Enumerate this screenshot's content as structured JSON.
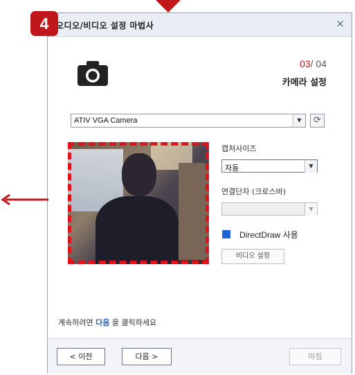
{
  "dialog": {
    "title": "오디오/비디오 설정 마법사",
    "close_glyph": "×"
  },
  "step_badge": "4",
  "step": {
    "current": "03",
    "separator": "/",
    "total": "04"
  },
  "subtitle": "카메라 설정",
  "camera": {
    "selected": "ATIV VGA Camera",
    "refresh_glyph": "⟳"
  },
  "capture_size": {
    "label": "캡처사이즈",
    "selected": "자동"
  },
  "connector": {
    "label": "연결단자 (크로스바)",
    "selected": ""
  },
  "directdraw": {
    "label": "DirectDraw 사용",
    "checked": true
  },
  "video_settings_button": "비디오 설정",
  "instruction": {
    "prefix": "계속하려면",
    "highlight": "다음",
    "suffix": "을 클릭하세요"
  },
  "buttons": {
    "prev": "< 이전",
    "next": "다음 >",
    "finish": "마침"
  },
  "icons": {
    "camera": "camera-icon",
    "dropdown": "chevron-down-icon",
    "refresh": "refresh-icon",
    "close": "close-icon"
  },
  "colors": {
    "accent_red": "#c0171b",
    "frame_red": "#e1121a",
    "link_blue": "#1f63d8",
    "title_bar": "#e9edf4"
  }
}
